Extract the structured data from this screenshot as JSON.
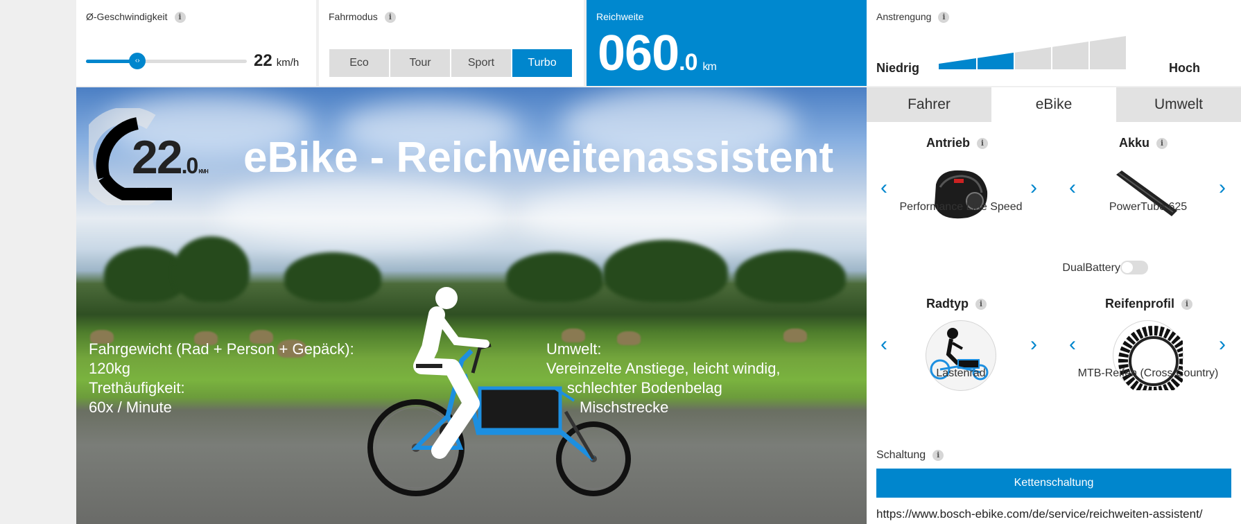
{
  "speed_panel": {
    "label": "Ø-Geschwindigkeit",
    "value": "22",
    "unit": "km/h",
    "slider_level": 0.32
  },
  "mode_panel": {
    "label": "Fahrmodus",
    "modes": [
      "Eco",
      "Tour",
      "Sport",
      "Turbo"
    ],
    "active": "Turbo"
  },
  "range_panel": {
    "label": "Reichweite",
    "value_int": "060",
    "value_dec": ".0",
    "unit": "km"
  },
  "effort_panel": {
    "label": "Anstrengung",
    "low_label": "Niedrig",
    "high_label": "Hoch",
    "level": 2,
    "levels": 5
  },
  "hero": {
    "gauge_int": "22",
    "gauge_dec": ".0",
    "gauge_unit": "KM/H",
    "title": "eBike - Reichweitenassistent",
    "left_lines": [
      "Fahrgewicht (Rad + Person + Gepäck):",
      "120kg",
      "Trethäufigkeit:",
      "60x / Minute"
    ],
    "right_lines": [
      "Umwelt:",
      "Vereinzelte Anstiege, leicht windig,",
      "schlechter Bodenbelag",
      "Mischstrecke"
    ]
  },
  "tabs": [
    "Fahrer",
    "eBike",
    "Umwelt"
  ],
  "active_tab": "eBike",
  "config": {
    "drive": {
      "title": "Antrieb",
      "value": "Performance Line Speed",
      "icon": "motor-icon"
    },
    "battery": {
      "title": "Akku",
      "value": "PowerTube 625",
      "icon": "battery-icon"
    },
    "dual_battery": {
      "label": "DualBattery",
      "on": false
    },
    "bike_type": {
      "title": "Radtyp",
      "value": "Lastenrad",
      "icon": "cargo-bike-icon"
    },
    "tire": {
      "title": "Reifenprofil",
      "value": "MTB-Reifen (Cross Country)",
      "icon": "tire-icon"
    },
    "gear": {
      "label": "Schaltung",
      "value": "Kettenschaltung"
    }
  },
  "url": "https://www.bosch-ebike.com/de/service/reichweiten-assistent/",
  "colors": {
    "accent": "#0086cd",
    "range_bg": "#0088cf"
  },
  "info_glyph": "i",
  "arrows": {
    "prev": "‹",
    "next": "›"
  }
}
